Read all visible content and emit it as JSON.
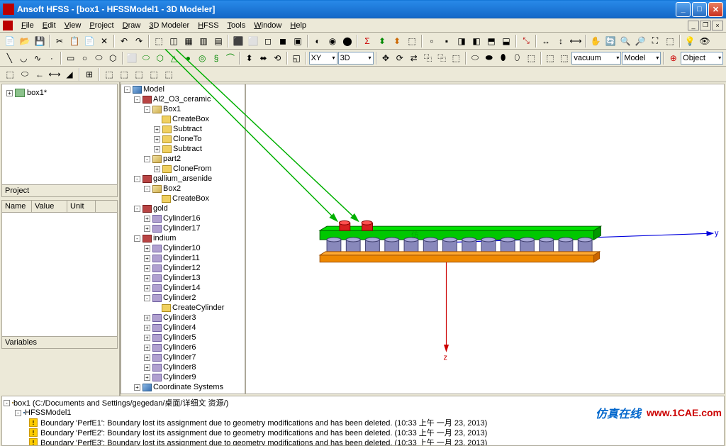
{
  "titlebar": {
    "text": "Ansoft HFSS - [box1 - HFSSModel1 - 3D Modeler]"
  },
  "menus": [
    "File",
    "Edit",
    "View",
    "Project",
    "Draw",
    "3D Modeler",
    "HFSS",
    "Tools",
    "Window",
    "Help"
  ],
  "toolbar2": {
    "coord": "XY",
    "mode": "3D",
    "material": "vacuum",
    "model": "Model",
    "object": "Object"
  },
  "project_panel": {
    "root": "box1*",
    "label": "Project"
  },
  "props": {
    "cols": [
      "Name",
      "Value",
      "Unit"
    ],
    "tab": "Variables"
  },
  "tree": {
    "root": "Model",
    "nodes": [
      {
        "d": 0,
        "e": "-",
        "ic": "ic-model",
        "t": "Model"
      },
      {
        "d": 1,
        "e": "-",
        "ic": "ic-mat",
        "t": "Al2_O3_ceramic"
      },
      {
        "d": 2,
        "e": "-",
        "ic": "ic-box",
        "t": "Box1"
      },
      {
        "d": 3,
        "e": " ",
        "ic": "ic-cmd",
        "t": "CreateBox"
      },
      {
        "d": 3,
        "e": "+",
        "ic": "ic-cmd",
        "t": "Subtract"
      },
      {
        "d": 3,
        "e": "+",
        "ic": "ic-cmd",
        "t": "CloneTo"
      },
      {
        "d": 3,
        "e": "+",
        "ic": "ic-cmd",
        "t": "Subtract"
      },
      {
        "d": 2,
        "e": "-",
        "ic": "ic-box",
        "t": "part2"
      },
      {
        "d": 3,
        "e": "+",
        "ic": "ic-cmd",
        "t": "CloneFrom"
      },
      {
        "d": 1,
        "e": "-",
        "ic": "ic-mat",
        "t": "gallium_arsenide"
      },
      {
        "d": 2,
        "e": "-",
        "ic": "ic-box",
        "t": "Box2"
      },
      {
        "d": 3,
        "e": " ",
        "ic": "ic-cmd",
        "t": "CreateBox"
      },
      {
        "d": 1,
        "e": "-",
        "ic": "ic-mat",
        "t": "gold"
      },
      {
        "d": 2,
        "e": "+",
        "ic": "ic-cyl",
        "t": "Cylinder16"
      },
      {
        "d": 2,
        "e": "+",
        "ic": "ic-cyl",
        "t": "Cylinder17"
      },
      {
        "d": 1,
        "e": "-",
        "ic": "ic-mat",
        "t": "indium"
      },
      {
        "d": 2,
        "e": "+",
        "ic": "ic-cyl",
        "t": "Cylinder10"
      },
      {
        "d": 2,
        "e": "+",
        "ic": "ic-cyl",
        "t": "Cylinder11"
      },
      {
        "d": 2,
        "e": "+",
        "ic": "ic-cyl",
        "t": "Cylinder12"
      },
      {
        "d": 2,
        "e": "+",
        "ic": "ic-cyl",
        "t": "Cylinder13"
      },
      {
        "d": 2,
        "e": "+",
        "ic": "ic-cyl",
        "t": "Cylinder14"
      },
      {
        "d": 2,
        "e": "-",
        "ic": "ic-cyl",
        "t": "Cylinder2"
      },
      {
        "d": 3,
        "e": " ",
        "ic": "ic-cmd",
        "t": "CreateCylinder"
      },
      {
        "d": 2,
        "e": "+",
        "ic": "ic-cyl",
        "t": "Cylinder3"
      },
      {
        "d": 2,
        "e": "+",
        "ic": "ic-cyl",
        "t": "Cylinder4"
      },
      {
        "d": 2,
        "e": "+",
        "ic": "ic-cyl",
        "t": "Cylinder5"
      },
      {
        "d": 2,
        "e": "+",
        "ic": "ic-cyl",
        "t": "Cylinder6"
      },
      {
        "d": 2,
        "e": "+",
        "ic": "ic-cyl",
        "t": "Cylinder7"
      },
      {
        "d": 2,
        "e": "+",
        "ic": "ic-cyl",
        "t": "Cylinder8"
      },
      {
        "d": 2,
        "e": "+",
        "ic": "ic-cyl",
        "t": "Cylinder9"
      },
      {
        "d": 1,
        "e": "+",
        "ic": "ic-model",
        "t": "Coordinate Systems"
      }
    ]
  },
  "messages": {
    "root": "box1 (C:/Documents and Settings/gegedan/桌面/详细文 资源/)",
    "model": "HFSSModel1",
    "warnings": [
      "Boundary 'PerfE1': Boundary lost its assignment due to geometry modifications and has been deleted. (10:33 上午  一月 23, 2013)",
      "Boundary 'PerfE2': Boundary lost its assignment due to geometry modifications and has been deleted. (10:33 上午  一月 23, 2013)",
      "Boundary 'PerfE3': Boundary lost its assignment due to geometry modifications and has been deleted. (10:33 上午  一月 23, 2013)"
    ]
  },
  "watermark": {
    "text": "仿真在线",
    "url": "www.1CAE.com"
  }
}
